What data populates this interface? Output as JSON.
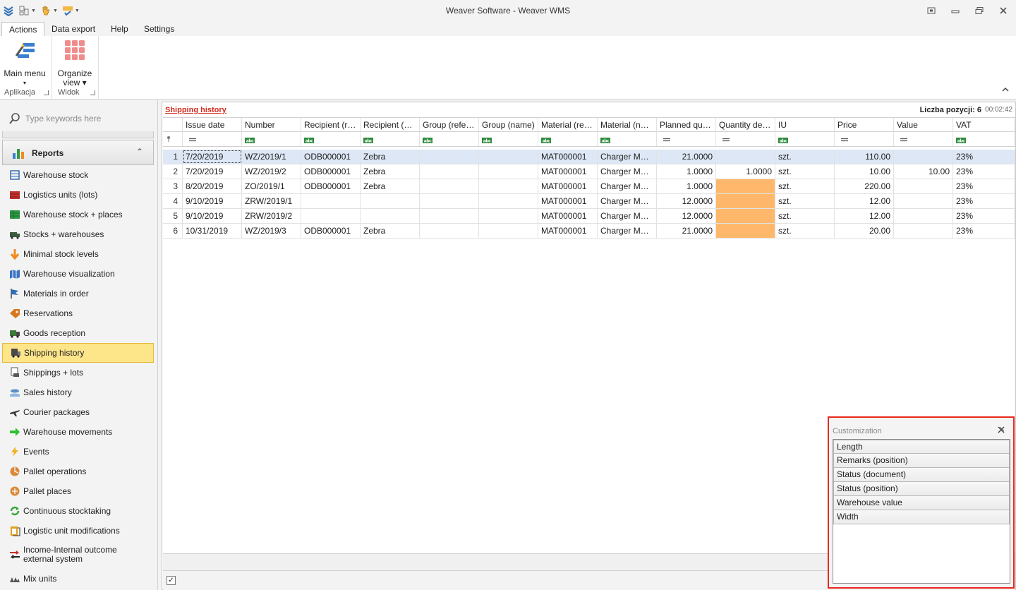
{
  "window": {
    "title": "Weaver Software - Weaver WMS"
  },
  "ribbon": {
    "tabs": [
      {
        "label": "Actions"
      },
      {
        "label": "Data export"
      },
      {
        "label": "Help"
      },
      {
        "label": "Settings"
      }
    ],
    "groups": [
      {
        "label": "Aplikacja",
        "button_line1": "Main menu",
        "button_line2": "▾"
      },
      {
        "label": "Widok",
        "button_line1": "Organize",
        "button_line2": "view ▾"
      }
    ]
  },
  "sidebar": {
    "search_placeholder": "Type keywords here",
    "group_label": "Reports",
    "items": [
      {
        "label": "Warehouse stock",
        "icon": "shelf-icon",
        "color": "#2f6db5"
      },
      {
        "label": "Logistics units (lots)",
        "icon": "crate-icon",
        "color": "#c4302b"
      },
      {
        "label": "Warehouse stock + places",
        "icon": "shelf-places-icon",
        "color": "#2e9a45"
      },
      {
        "label": "Stocks + warehouses",
        "icon": "truck-stock-icon",
        "color": "#3d5a3d"
      },
      {
        "label": "Minimal stock levels",
        "icon": "arrow-down-icon",
        "color": "#f08a1c"
      },
      {
        "label": "Warehouse visualization",
        "icon": "map-icon",
        "color": "#3a73c4"
      },
      {
        "label": "Materials in order",
        "icon": "flag-icon",
        "color": "#2f6db5"
      },
      {
        "label": "Reservations",
        "icon": "tag-icon",
        "color": "#d9771e"
      },
      {
        "label": "Goods reception",
        "icon": "truck-icon",
        "color": "#4a4a4a"
      },
      {
        "label": "Shipping history",
        "icon": "shipping-truck-icon",
        "color": "#4a4a4a"
      },
      {
        "label": "Shippings + lots",
        "icon": "document-truck-icon",
        "color": "#555555"
      },
      {
        "label": "Sales history",
        "icon": "hand-coins-icon",
        "color": "#5c8fc7"
      },
      {
        "label": "Courier packages",
        "icon": "airplane-icon",
        "color": "#333333"
      },
      {
        "label": "Warehouse movements",
        "icon": "green-arrow-icon",
        "color": "#2fbf2f"
      },
      {
        "label": "Events",
        "icon": "lightning-icon",
        "color": "#f2b01e"
      },
      {
        "label": "Pallet operations",
        "icon": "pallet-icon",
        "color": "#d98a3a"
      },
      {
        "label": "Pallet places",
        "icon": "pallet-place-icon",
        "color": "#d98a3a"
      },
      {
        "label": "Continuous stocktaking",
        "icon": "refresh-icon",
        "color": "#3aa63a"
      },
      {
        "label": "Logistic unit modifications",
        "icon": "clipboard-icon",
        "color": "#e0a020"
      },
      {
        "label": "Income-Internal outcome external system",
        "icon": "transfer-arrows-icon",
        "color": "#c4302b"
      },
      {
        "label": "Mix units",
        "icon": "mix-units-icon",
        "color": "#555555"
      }
    ],
    "selected_index": 9
  },
  "document": {
    "tab_label": "Shipping history",
    "count_label": "Liczba pozycji: 6",
    "time": "00:02:42"
  },
  "grid": {
    "columns": [
      "Issue date",
      "Number",
      "Recipient (ref...",
      "Recipient (na...",
      "Group (refere...",
      "Group (name)",
      "Material (refe...",
      "Material (name)",
      "Planned quan...",
      "Quantity deliv...",
      "IU",
      "Price",
      "Value",
      "VAT"
    ],
    "filter_types": [
      "eq",
      "abc",
      "abc",
      "abc",
      "abc",
      "abc",
      "abc",
      "abc",
      "eq",
      "eq",
      "abc",
      "eq",
      "eq",
      "abc"
    ],
    "rows": [
      {
        "n": "1",
        "cells": [
          "7/20/2019",
          "WZ/2019/1",
          "ODB000001",
          "Zebra",
          "",
          "",
          "MAT000001",
          "Charger MS221",
          "21.0000",
          "",
          "szt.",
          "110.00",
          "",
          "23%"
        ],
        "highlight": false
      },
      {
        "n": "2",
        "cells": [
          "7/20/2019",
          "WZ/2019/2",
          "ODB000001",
          "Zebra",
          "",
          "",
          "MAT000001",
          "Charger MS221",
          "1.0000",
          "1.0000",
          "szt.",
          "10.00",
          "10.00",
          "23%"
        ],
        "highlight": false
      },
      {
        "n": "3",
        "cells": [
          "8/20/2019",
          "ZO/2019/1",
          "ODB000001",
          "Zebra",
          "",
          "",
          "MAT000001",
          "Charger MS221",
          "1.0000",
          "",
          "szt.",
          "220.00",
          "",
          "23%"
        ],
        "highlight": true
      },
      {
        "n": "4",
        "cells": [
          "9/10/2019",
          "ZRW/2019/1",
          "",
          "",
          "",
          "",
          "MAT000001",
          "Charger MS221",
          "12.0000",
          "",
          "szt.",
          "12.00",
          "",
          "23%"
        ],
        "highlight": true
      },
      {
        "n": "5",
        "cells": [
          "9/10/2019",
          "ZRW/2019/2",
          "",
          "",
          "",
          "",
          "MAT000001",
          "Charger MS221",
          "12.0000",
          "",
          "szt.",
          "12.00",
          "",
          "23%"
        ],
        "highlight": true
      },
      {
        "n": "6",
        "cells": [
          "10/31/2019",
          "WZ/2019/3",
          "ODB000001",
          "Zebra",
          "",
          "",
          "MAT000001",
          "Charger MS221",
          "21.0000",
          "",
          "szt.",
          "20.00",
          "",
          "23%"
        ],
        "highlight": true
      }
    ],
    "selected_row": 0,
    "highlight_color": "#ffb86b"
  },
  "customization": {
    "title": "Customization",
    "items": [
      "Length",
      "Remarks (position)",
      "Status (document)",
      "Status (position)",
      "Warehouse value",
      "Width"
    ]
  },
  "colors": {
    "accent_red": "#d52b1e",
    "selection_yellow": "#fde58a",
    "panel_border_red": "#e8271d"
  }
}
